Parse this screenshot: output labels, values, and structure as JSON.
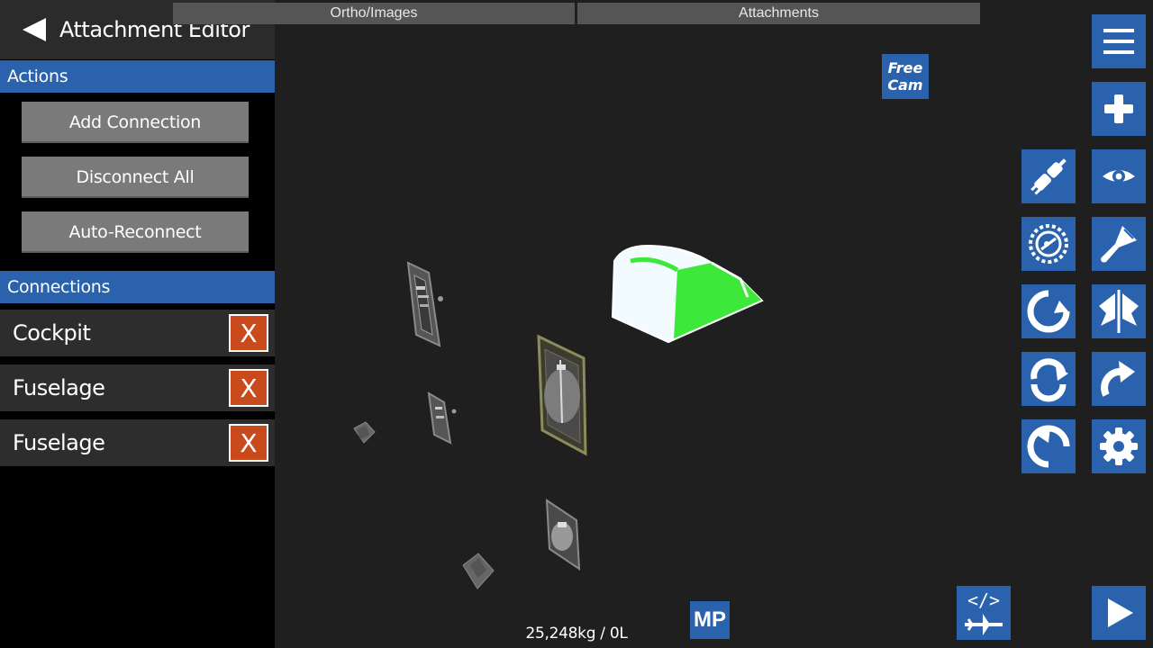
{
  "header": {
    "title": "Attachment Editor"
  },
  "tabs": [
    {
      "label": "Ortho/Images"
    },
    {
      "label": "Attachments"
    }
  ],
  "actions": {
    "section_label": "Actions",
    "buttons": [
      {
        "label": "Add Connection"
      },
      {
        "label": "Disconnect All"
      },
      {
        "label": "Auto-Reconnect"
      }
    ]
  },
  "connections": {
    "section_label": "Connections",
    "items": [
      {
        "label": "Cockpit",
        "remove_label": "X"
      },
      {
        "label": "Fuselage",
        "remove_label": "X"
      },
      {
        "label": "Fuselage",
        "remove_label": "X"
      }
    ]
  },
  "viewport": {
    "free_cam_line1": "Free",
    "free_cam_line2": "Cam",
    "mp_label": "MP",
    "mass_readout": "25,248kg / 0L"
  },
  "toolbar_icons": [
    "menu-icon",
    "add-part-icon",
    "connect-plug-icon",
    "view-eye-icon",
    "gyro-gear-icon",
    "paint-brush-icon",
    "rotate-icon",
    "symmetry-icon",
    "rotate-cw-icon",
    "redo-icon",
    "undo-icon",
    "settings-icon",
    "code-plane-icon",
    "play-icon"
  ],
  "colors": {
    "accent": "#2a62ad",
    "delete": "#c94a1c",
    "cockpit_glass": "#3ee83a",
    "panel_bg": "#000000",
    "viewport_bg": "#1f1f1f"
  }
}
